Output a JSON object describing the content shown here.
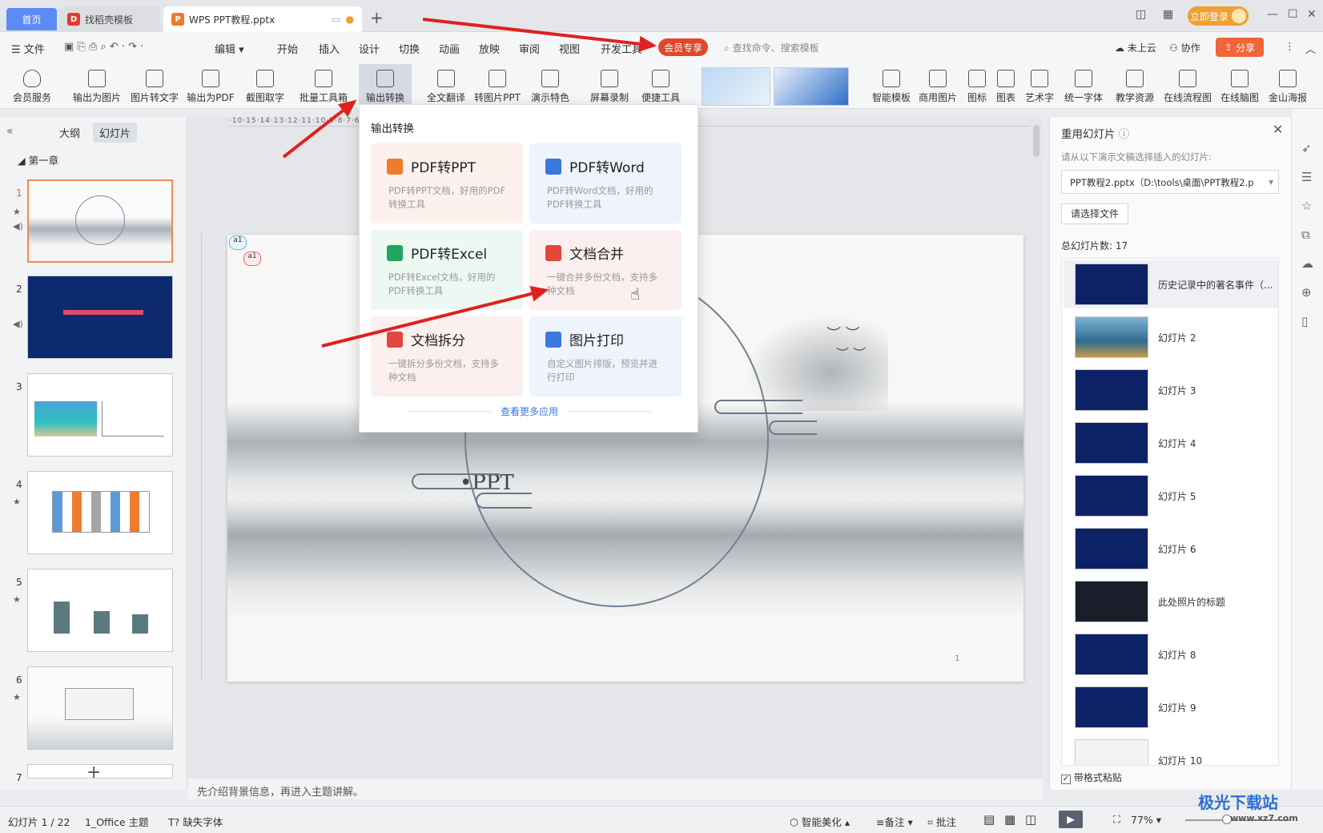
{
  "titlebar": {
    "home": "首页",
    "tab1": "找稻壳模板",
    "tab2": "WPS PPT教程.pptx",
    "login": "立即登录"
  },
  "menu": {
    "file": "文件",
    "edit": "编辑",
    "items": [
      "开始",
      "插入",
      "设计",
      "切换",
      "动画",
      "放映",
      "审阅",
      "视图",
      "开发工具"
    ],
    "vip": "会员专享",
    "search": "查找命令、搜索模板",
    "cloud": "未上云",
    "collab": "协作",
    "share": "分享"
  },
  "ribbon": {
    "items": [
      "会员服务",
      "输出为图片",
      "图片转文字",
      "输出为PDF",
      "截图取字",
      "批量工具箱",
      "输出转换",
      "全文翻译",
      "转图片PPT",
      "演示特色",
      "屏幕录制",
      "便捷工具",
      "智能模板",
      "商用图片",
      "图标",
      "图表",
      "艺术字",
      "统一字体",
      "教学资源",
      "在线流程图",
      "在线脑图",
      "金山海报"
    ]
  },
  "left": {
    "tab_outline": "大纲",
    "tab_slides": "幻灯片",
    "chapter": "第一章",
    "nums": [
      "1",
      "2",
      "3",
      "4",
      "5",
      "6",
      "7"
    ]
  },
  "dropdown": {
    "title": "输出转换",
    "cards": [
      {
        "title": "PDF转PPT",
        "desc": "PDF转PPT文档，好用的PDF转换工具"
      },
      {
        "title": "PDF转Word",
        "desc": "PDF转Word文档，好用的PDF转换工具"
      },
      {
        "title": "PDF转Excel",
        "desc": "PDF转Excel文档，好用的PDF转换工具"
      },
      {
        "title": "文档合并",
        "desc": "一键合并多份文档，支持多种文档"
      },
      {
        "title": "文档拆分",
        "desc": "一键拆分多份文档，支持多种文档"
      },
      {
        "title": "图片打印",
        "desc": "自定义图片排版，预览并进行打印"
      }
    ],
    "more": "查看更多应用"
  },
  "slide": {
    "text": "•PPT",
    "page": "1",
    "comment1": "a1",
    "comment2": "a1"
  },
  "right": {
    "title": "重用幻灯片",
    "hint": "请从以下演示文稿选择插入的幻灯片:",
    "file": "PPT教程2.pptx（D:\\tools\\桌面\\PPT教程2.p",
    "choose": "请选择文件",
    "count": "总幻灯片数: 17",
    "items": [
      "历史记录中的著名事件（...",
      "幻灯片 2",
      "幻灯片 3",
      "幻灯片 4",
      "幻灯片 5",
      "幻灯片 6",
      "此处照片的标题",
      "幻灯片 8",
      "幻灯片 9",
      "幻灯片 10"
    ],
    "keep": "带格式粘贴"
  },
  "notes": "先介绍背景信息，再进入主题讲解。",
  "status": {
    "slide": "幻灯片 1 / 22",
    "theme": "1_Office 主题",
    "font": "缺失字体",
    "beautify": "智能美化",
    "notes": "备注",
    "comment": "批注",
    "zoom": "77%"
  },
  "watermark": {
    "name": "极光下载站",
    "url": "www.xz7.com"
  }
}
